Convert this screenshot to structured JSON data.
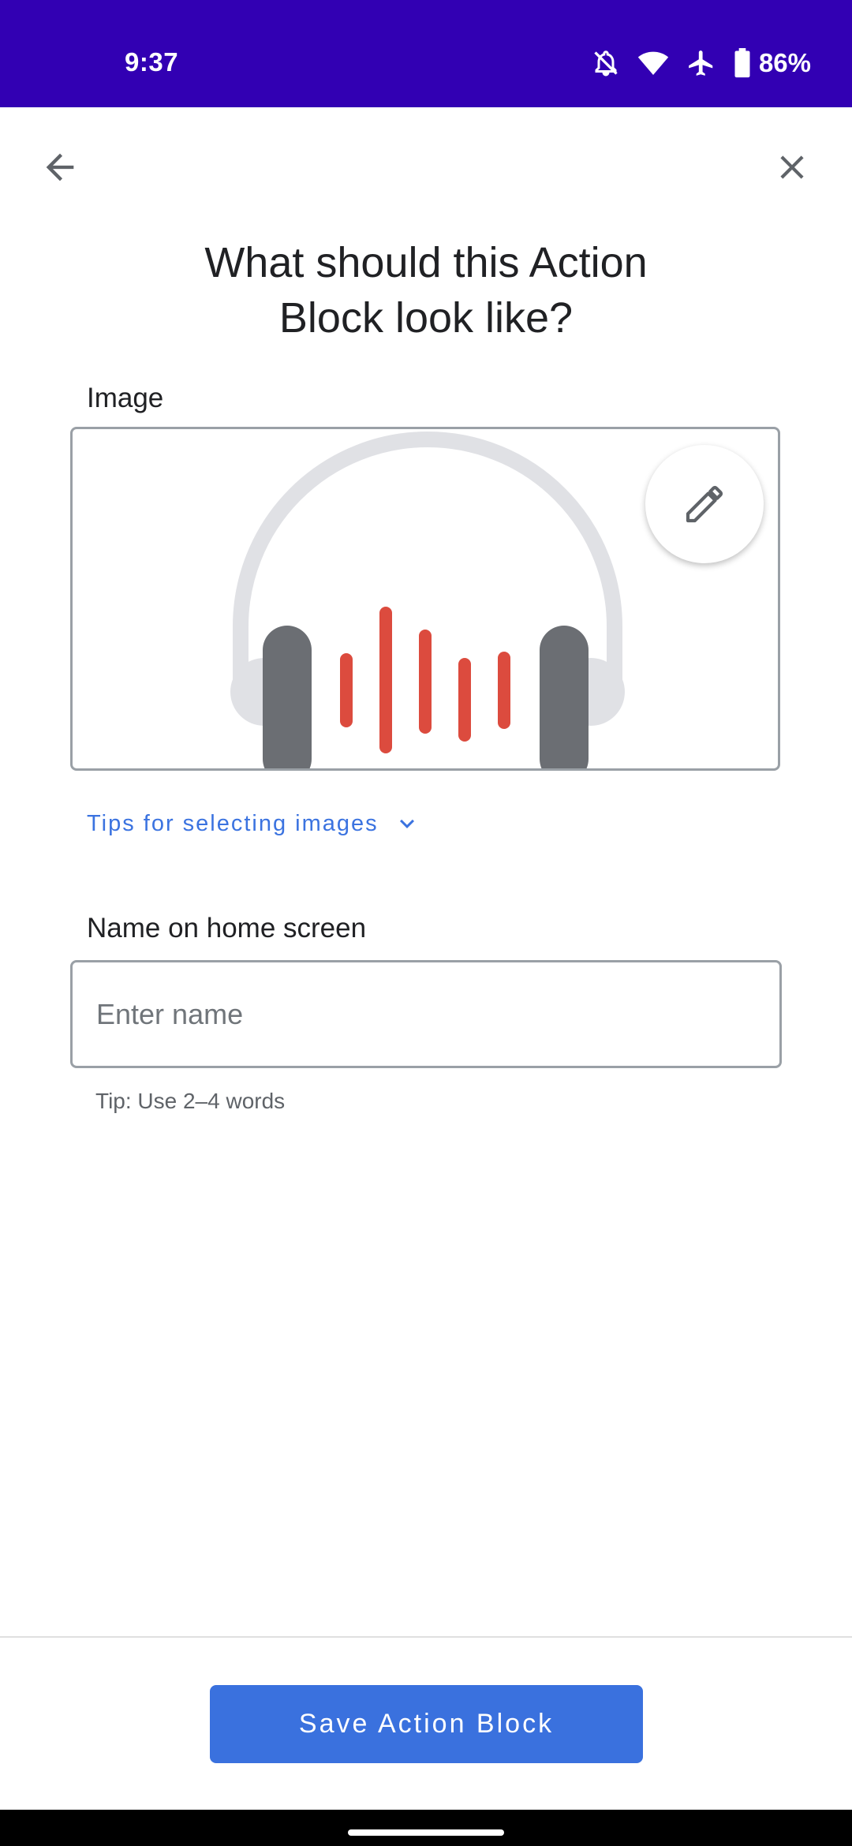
{
  "status_bar": {
    "time": "9:37",
    "battery_percent": "86%",
    "icons": [
      "notifications-off-icon",
      "wifi-icon",
      "airplane-icon",
      "battery-icon"
    ]
  },
  "top_bar": {
    "back_icon": "arrow-back-icon",
    "close_icon": "close-icon"
  },
  "title": "What should this Action\nBlock look like?",
  "image_section": {
    "label": "Image",
    "image_icon": "headphones-icon",
    "edit_icon": "pencil-icon",
    "colors": {
      "band": "#e0e1e5",
      "cups": "#6b6e73",
      "wave": "#dc4b3e"
    }
  },
  "tips": {
    "label": "Tips for selecting images",
    "icon": "chevron-down-icon",
    "color": "#3b73e0"
  },
  "name_section": {
    "label": "Name on home screen",
    "placeholder": "Enter name",
    "value": "",
    "helper": "Tip: Use 2–4 words"
  },
  "footer": {
    "save_label": "Save Action Block",
    "accent": "#3a71de"
  }
}
